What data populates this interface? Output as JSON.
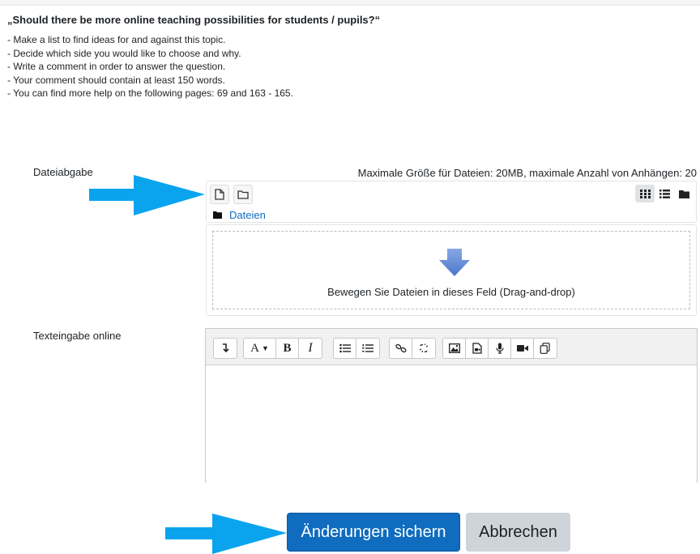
{
  "question": "„Should there be more online teaching possibilities for students / pupils?“",
  "instructions": [
    "- Make a list to find ideas for and against this topic.",
    "- Decide which side you would like to choose and why.",
    "- Write a comment in order to answer the question.",
    "- Your comment should contain at least 150 words.",
    "- You can find more help on the following pages: 69 and 163 - 165."
  ],
  "file_submission": {
    "label": "Dateiabgabe",
    "max_info": "Maximale Größe für Dateien: 20MB, maximale Anzahl von Anhängen: 20",
    "path_folder": "Dateien",
    "dropzone_text": "Bewegen Sie Dateien in dieses Feld (Drag-and-drop)"
  },
  "online_text": {
    "label": "Texteingabe online",
    "toolbar": {
      "paragraph_style": "A",
      "bold": "B",
      "italic": "I"
    }
  },
  "buttons": {
    "save": "Änderungen sichern",
    "cancel": "Abbrechen"
  },
  "colors": {
    "primary": "#0f6cbf",
    "annotation_arrow": "#0aa4ee",
    "drop_arrow": "#6a8fd6"
  }
}
